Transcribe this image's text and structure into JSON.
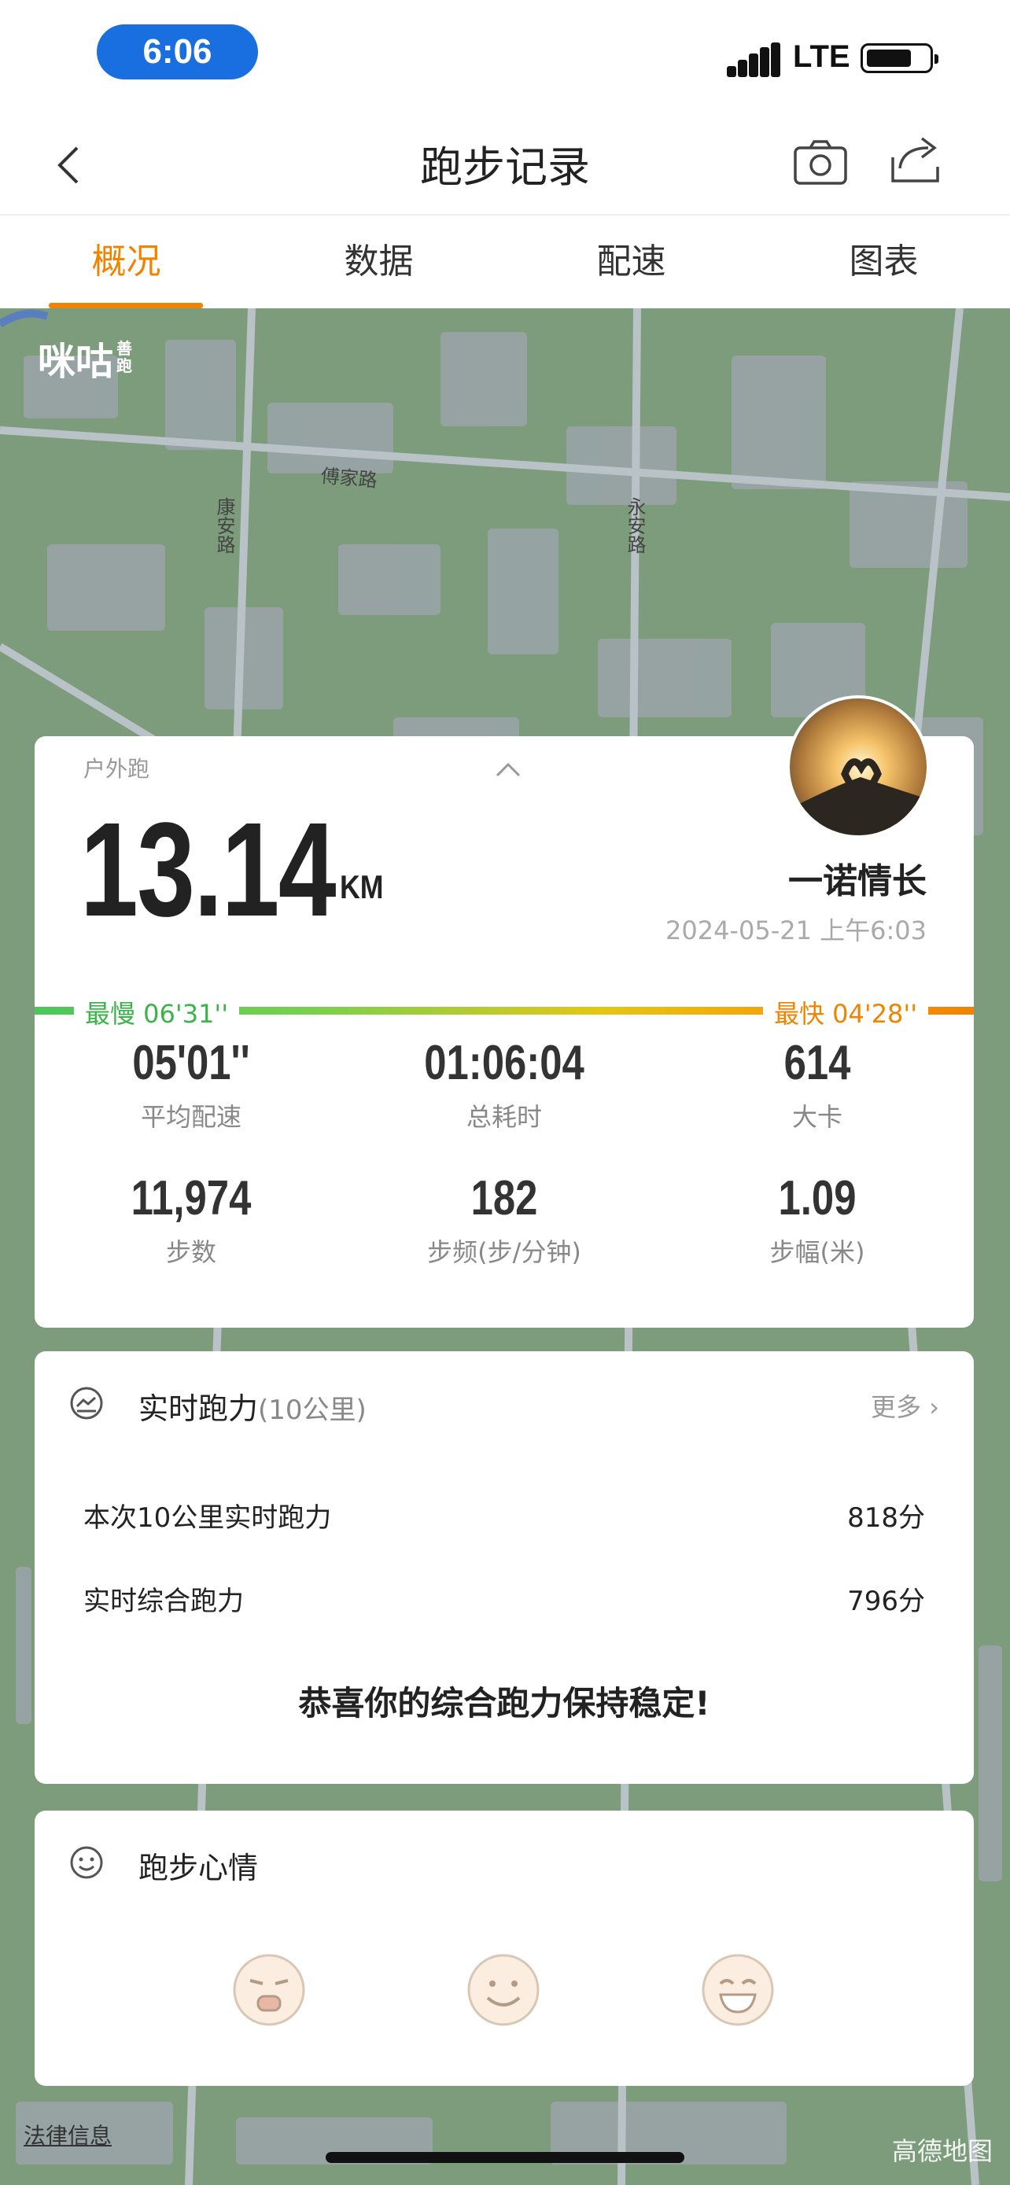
{
  "status_bar": {
    "time": "6:06",
    "network": "LTE"
  },
  "nav": {
    "title": "跑步记录"
  },
  "tabs": [
    {
      "label": "概况",
      "active": true
    },
    {
      "label": "数据",
      "active": false
    },
    {
      "label": "配速",
      "active": false
    },
    {
      "label": "图表",
      "active": false
    }
  ],
  "map": {
    "logo": "咪咕",
    "logo_sub": "善跑",
    "roads": [
      "傅家路",
      "康安路",
      "永安路"
    ],
    "legal_link": "法律信息",
    "provider": "高德地图"
  },
  "summary": {
    "run_type": "户外跑",
    "distance": "13.14",
    "unit": "KM",
    "username": "一诺情长",
    "datetime": "2024-05-21 上午6:03",
    "slowest": "最慢  06'31''",
    "fastest": "最快  04'28''",
    "stats": [
      {
        "value": "05'01''",
        "label": "平均配速"
      },
      {
        "value": "01:06:04",
        "label": "总耗时"
      },
      {
        "value": "614",
        "label": "大卡"
      },
      {
        "value": "11,974",
        "label": "步数"
      },
      {
        "value": "182",
        "label": "步频(步/分钟)"
      },
      {
        "value": "1.09",
        "label": "步幅(米)"
      }
    ]
  },
  "power": {
    "title": "实时跑力",
    "subtitle": "(10公里)",
    "more": "更多 ›",
    "rows": [
      {
        "label": "本次10公里实时跑力",
        "value": "818分"
      },
      {
        "label": "实时综合跑力",
        "value": "796分"
      }
    ],
    "message": "恭喜你的综合跑力保持稳定!"
  },
  "mood": {
    "title": "跑步心情"
  },
  "colors": {
    "accent": "#f08300",
    "slow": "#3cb34a",
    "map_green": "#7a9a7a"
  }
}
